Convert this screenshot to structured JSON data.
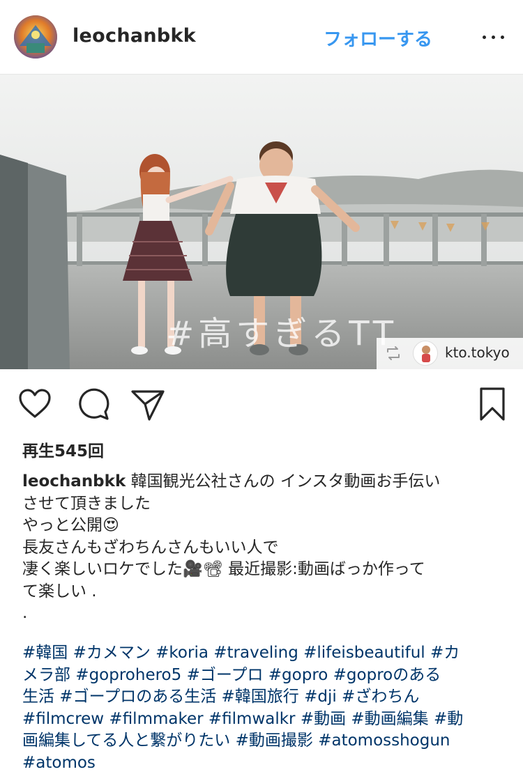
{
  "header": {
    "username": "leochanbkk",
    "follow_label": "フォローする",
    "more_icon": "more-icon"
  },
  "media": {
    "watermark_text": "#高すぎるTT",
    "repost_credit": "kto.tokyo"
  },
  "actions": {
    "icons": [
      "heart-icon",
      "comment-icon",
      "share-icon",
      "bookmark-icon"
    ]
  },
  "views": "再生545回",
  "caption": {
    "username": "leochanbkk",
    "lines": [
      "韓国観光公社さんの インスタ動画お手伝い",
      "させて頂きました",
      "やっと公開😍",
      "長友さんもざわちんさんもいい人で",
      "凄く楽しいロケでした🎥📽 最近撮影:動画ばっか作って",
      "て楽しい .",
      "."
    ],
    "tag_rows": [
      "#韓国 #カメマン #koria #traveling #lifeisbeautiful #カ",
      "メラ部 #goprohero5 #ゴープロ #gopro #goproのある",
      "生活 #ゴープロのある生活 #韓国旅行 #dji #ざわちん",
      "#filmcrew #filmmaker #filmwalkr #動画 #動画編集 #動",
      "画編集してる人と繋がりたい #動画撮影 #atomosshogun",
      "#atomos"
    ]
  },
  "colors": {
    "link_blue": "#3897f0",
    "hashtag": "#003569",
    "text": "#262626"
  }
}
